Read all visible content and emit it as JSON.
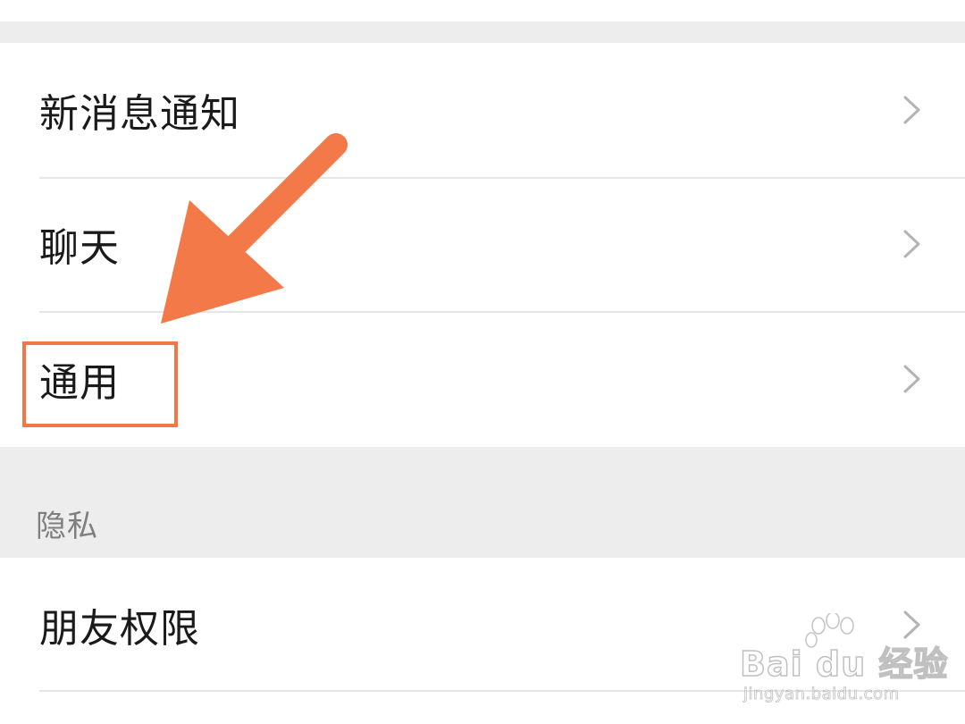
{
  "settings": {
    "group_general": [
      {
        "label": "新消息通知"
      },
      {
        "label": "聊天"
      },
      {
        "label": "通用"
      }
    ],
    "privacy_header": "隐私",
    "group_privacy": [
      {
        "label": "朋友权限"
      }
    ]
  },
  "annotation": {
    "highlight_color": "#f07848",
    "arrow_color": "#f37a48"
  },
  "watermark": {
    "brand": "Bai du 经验",
    "url": "jingyan.baidu.com"
  },
  "colors": {
    "background": "#ededed",
    "row_background": "#ffffff",
    "text": "#1a1a1a",
    "section_header_text": "#7f7f7f",
    "chevron": "#b3b3b3",
    "divider": "#e6e6e6"
  }
}
